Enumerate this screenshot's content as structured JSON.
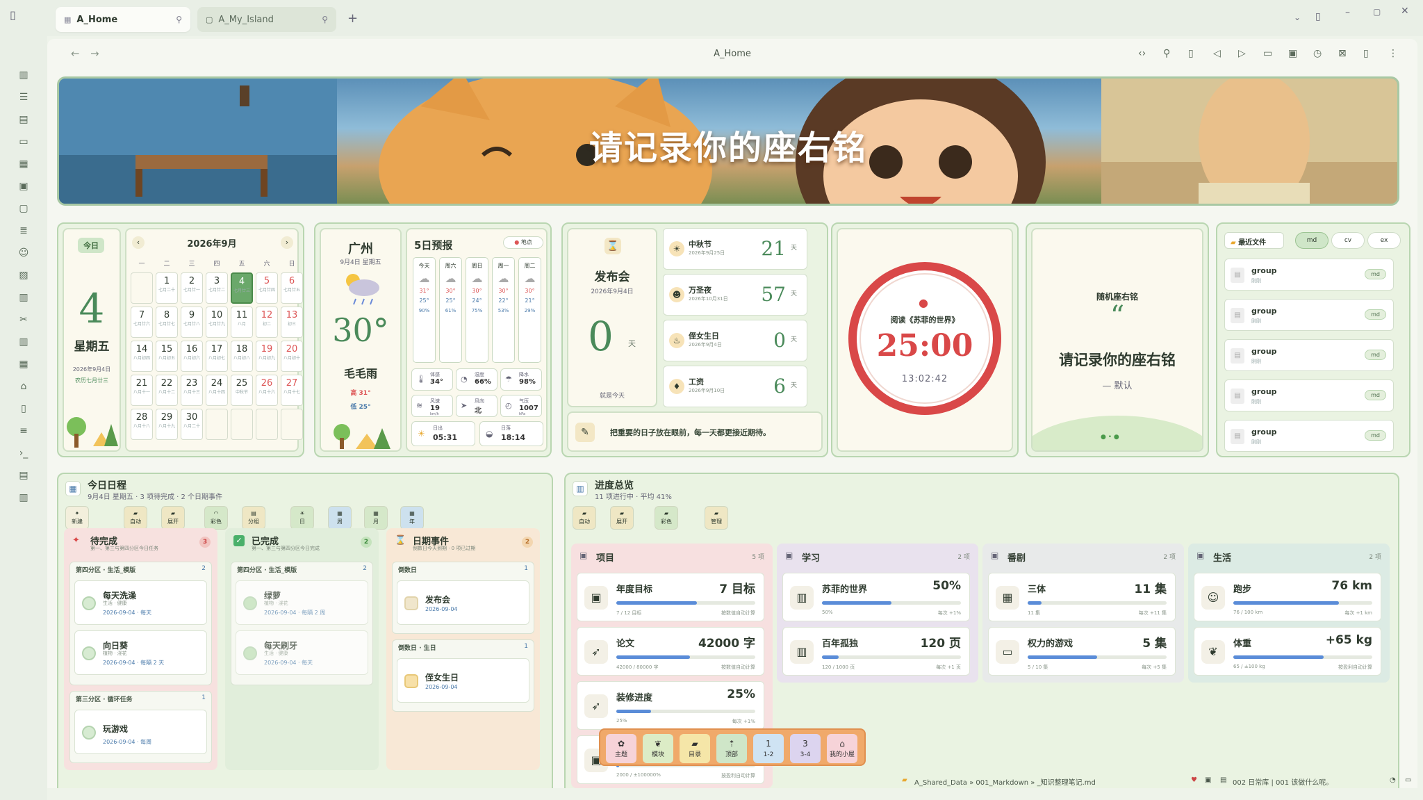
{
  "tabs": [
    {
      "label": "A_Home"
    },
    {
      "label": "A_My_Island"
    }
  ],
  "nav": {
    "title": "A_Home"
  },
  "banner": {
    "motto": "请记录你的座右铭"
  },
  "today": {
    "badge": "今日",
    "day": "4",
    "weekday": "星期五",
    "date": "2026年9月4日",
    "lunar": "农历七月廿三"
  },
  "calendar": {
    "title": "2026年9月",
    "weekdays": [
      "一",
      "二",
      "三",
      "四",
      "五",
      "六",
      "日"
    ],
    "cells": [
      {
        "d": "",
        "l": ""
      },
      {
        "d": "1",
        "l": "七月二十"
      },
      {
        "d": "2",
        "l": "七月廿一"
      },
      {
        "d": "3",
        "l": "七月廿二"
      },
      {
        "d": "4",
        "l": "七月廿三"
      },
      {
        "d": "5",
        "l": "七月廿四"
      },
      {
        "d": "6",
        "l": "七月廿五"
      },
      {
        "d": "7",
        "l": "七月廿六"
      },
      {
        "d": "8",
        "l": "七月廿七"
      },
      {
        "d": "9",
        "l": "七月廿八"
      },
      {
        "d": "10",
        "l": "七月廿九"
      },
      {
        "d": "11",
        "l": "八月"
      },
      {
        "d": "12",
        "l": "初二"
      },
      {
        "d": "13",
        "l": "初三"
      },
      {
        "d": "14",
        "l": "八月初四"
      },
      {
        "d": "15",
        "l": "八月初五"
      },
      {
        "d": "16",
        "l": "八月初六"
      },
      {
        "d": "17",
        "l": "八月初七"
      },
      {
        "d": "18",
        "l": "八月初八"
      },
      {
        "d": "19",
        "l": "八月初九"
      },
      {
        "d": "20",
        "l": "八月初十"
      },
      {
        "d": "21",
        "l": "八月十一"
      },
      {
        "d": "22",
        "l": "八月十二"
      },
      {
        "d": "23",
        "l": "八月十三"
      },
      {
        "d": "24",
        "l": "八月十四"
      },
      {
        "d": "25",
        "l": "中秋节"
      },
      {
        "d": "26",
        "l": "八月十六"
      },
      {
        "d": "27",
        "l": "八月十七"
      },
      {
        "d": "28",
        "l": "八月十八"
      },
      {
        "d": "29",
        "l": "八月十九"
      },
      {
        "d": "30",
        "l": "八月二十"
      },
      {
        "d": "",
        "l": ""
      },
      {
        "d": "",
        "l": ""
      },
      {
        "d": "",
        "l": ""
      },
      {
        "d": "",
        "l": ""
      }
    ]
  },
  "weather": {
    "city": "广州",
    "date": "9月4日 星期五",
    "temp": "30°",
    "desc": "毛毛雨",
    "high": "高 31°",
    "low": "低 25°",
    "forecast_title": "5日预报",
    "location_btn": "地点",
    "days": [
      {
        "d": "今天",
        "hi": "31°",
        "lo": "25°",
        "p": "90%"
      },
      {
        "d": "周六",
        "hi": "30°",
        "lo": "25°",
        "p": "61%"
      },
      {
        "d": "周日",
        "hi": "30°",
        "lo": "24°",
        "p": "75%"
      },
      {
        "d": "周一",
        "hi": "30°",
        "lo": "22°",
        "p": "53%"
      },
      {
        "d": "周二",
        "hi": "30°",
        "lo": "21°",
        "p": "29%"
      }
    ],
    "stats": [
      {
        "k": "体感",
        "v": "34°"
      },
      {
        "k": "湿度",
        "v": "66%"
      },
      {
        "k": "降水",
        "v": "98%"
      },
      {
        "k": "风速",
        "v": "19",
        "u": "km/h"
      },
      {
        "k": "风向",
        "v": "北"
      },
      {
        "k": "气压",
        "v": "1007",
        "u": "hPa"
      }
    ],
    "sunrise_label": "日出",
    "sunrise": "05:31",
    "sunset_label": "日落",
    "sunset": "18:14"
  },
  "event": {
    "title": "发布会",
    "date": "2026年9月4日",
    "days": "0",
    "unit": "天",
    "note": "就是今天",
    "countdowns": [
      {
        "name": "中秋节",
        "date": "2026年9月25日",
        "n": "21",
        "u": "天",
        "icon": "☀"
      },
      {
        "name": "万圣夜",
        "date": "2026年10月31日",
        "n": "57",
        "u": "天",
        "icon": "☻"
      },
      {
        "name": "侄女生日",
        "date": "2026年9月4日",
        "n": "0",
        "u": "天",
        "icon": "♨"
      },
      {
        "name": "工资",
        "date": "2026年9月10日",
        "n": "6",
        "u": "天",
        "icon": "♦"
      }
    ],
    "quote": "把重要的日子放在眼前，每一天都更接近期待。"
  },
  "pomodoro": {
    "task": "阅读《苏菲的世界》",
    "time": "25:00",
    "clock": "13:02:42"
  },
  "random_motto": {
    "title": "随机座右铭",
    "text": "请记录你的座右铭",
    "author": "— 默认"
  },
  "recent": {
    "title": "最近文件",
    "tabs": [
      "md",
      "cv",
      "ex"
    ],
    "files": [
      {
        "n": "group",
        "s": "刚刚",
        "b": "md"
      },
      {
        "n": "group",
        "s": "刚刚",
        "b": "md"
      },
      {
        "n": "group",
        "s": "刚刚",
        "b": "md"
      },
      {
        "n": "group",
        "s": "刚刚",
        "b": "md"
      },
      {
        "n": "group",
        "s": "刚刚",
        "b": "md"
      }
    ]
  },
  "schedule": {
    "title": "今日日程",
    "sub": "9月4日 星期五 · 3 项待完成 · 2 个日期事件",
    "buttons": [
      "新建",
      "自动",
      "展开",
      "彩色",
      "分组",
      "日",
      "周",
      "月",
      "年"
    ],
    "pending": {
      "title": "待完成",
      "sub": "第一、第三与第四分区今日任务",
      "count": "3",
      "g1": {
        "name": "第四分区 · 生活_模版",
        "count": "2",
        "tasks": [
          {
            "n": "每天洗澡",
            "t": "生活 · 健康",
            "d": "2026-09-04 · 每天"
          },
          {
            "n": "向日葵",
            "t": "植物 · 浇花",
            "d": "2026-09-04 · 每隔 2 天"
          }
        ]
      },
      "g2": {
        "name": "第三分区 · 循环任务",
        "count": "1",
        "tasks": [
          {
            "n": "玩游戏",
            "d": "2026-09-04 · 每周"
          }
        ]
      }
    },
    "done": {
      "title": "已完成",
      "sub": "第一、第三与第四分区今日完成",
      "count": "2",
      "g1": {
        "name": "第四分区 · 生活_模版",
        "count": "2",
        "tasks": [
          {
            "n": "绿萝",
            "t": "植物 · 浇花",
            "d": "2026-09-04 · 每隔 2 周"
          },
          {
            "n": "每天刷牙",
            "t": "生活 · 健康",
            "d": "2026-09-04 · 每天"
          }
        ]
      }
    },
    "dated": {
      "title": "日期事件",
      "sub": "倒数日今天到期 · 0 项已过期",
      "count": "2",
      "g1": {
        "name": "倒数日",
        "count": "1",
        "tasks": [
          {
            "n": "发布会",
            "d": "2026-09-04"
          }
        ]
      },
      "g2": {
        "name": "倒数日 · 生日",
        "count": "1",
        "tasks": [
          {
            "n": "侄女生日",
            "d": "2026-09-04"
          }
        ]
      }
    }
  },
  "progress": {
    "title": "进度总览",
    "sub": "11 项进行中 · 平均 41%",
    "buttons": [
      "自动",
      "展开",
      "彩色",
      "管理"
    ],
    "cols": [
      {
        "name": "项目",
        "count": "5 项",
        "items": [
          {
            "n": "年度目标",
            "v": "7 目标",
            "l": "7 / 12 目标",
            "r": "按数值自动计算",
            "p": 0.58
          },
          {
            "n": "论文",
            "v": "42000 字",
            "l": "42000 / 80000 字",
            "r": "按数值自动计算",
            "p": 0.53
          },
          {
            "n": "装修进度",
            "v": "25%",
            "l": "25%",
            "r": "每次 +1%",
            "p": 0.25
          },
          {
            "n": "",
            "v": "",
            "l": "2000 / ±100000%",
            "r": "按盈利自动计算",
            "p": 0.02
          }
        ]
      },
      {
        "name": "学习",
        "count": "2 项",
        "items": [
          {
            "n": "苏菲的世界",
            "v": "50%",
            "l": "50%",
            "r": "每次 +1%",
            "p": 0.5
          },
          {
            "n": "百年孤独",
            "v": "120 页",
            "l": "120 / 1000 页",
            "r": "每次 +1 页",
            "p": 0.12
          }
        ]
      },
      {
        "name": "番剧",
        "count": "2 项",
        "items": [
          {
            "n": "三体",
            "v": "11 集",
            "l": "11 集",
            "r": "每次 +11 集",
            "p": 0.1
          },
          {
            "n": "权力的游戏",
            "v": "5 集",
            "l": "5 / 10 集",
            "r": "每次 +5 集",
            "p": 0.5
          }
        ]
      },
      {
        "name": "生活",
        "count": "2 项",
        "items": [
          {
            "n": "跑步",
            "v": "76 km",
            "l": "76 / 100 km",
            "r": "每次 +1 km",
            "p": 0.76
          },
          {
            "n": "体重",
            "v": "+65 kg",
            "l": "65 / ±100 kg",
            "r": "按盈利自动计算",
            "p": 0.65
          }
        ]
      }
    ]
  },
  "floatbar": [
    "主题",
    "模块",
    "目录",
    "顶部",
    "1-2",
    "3-4",
    "我的小屋"
  ],
  "status": {
    "path": "A_Shared_Data » 001_Markdown » _知识整理笔记.md",
    "note": "002 日常库 | 001 该做什么呢。"
  }
}
